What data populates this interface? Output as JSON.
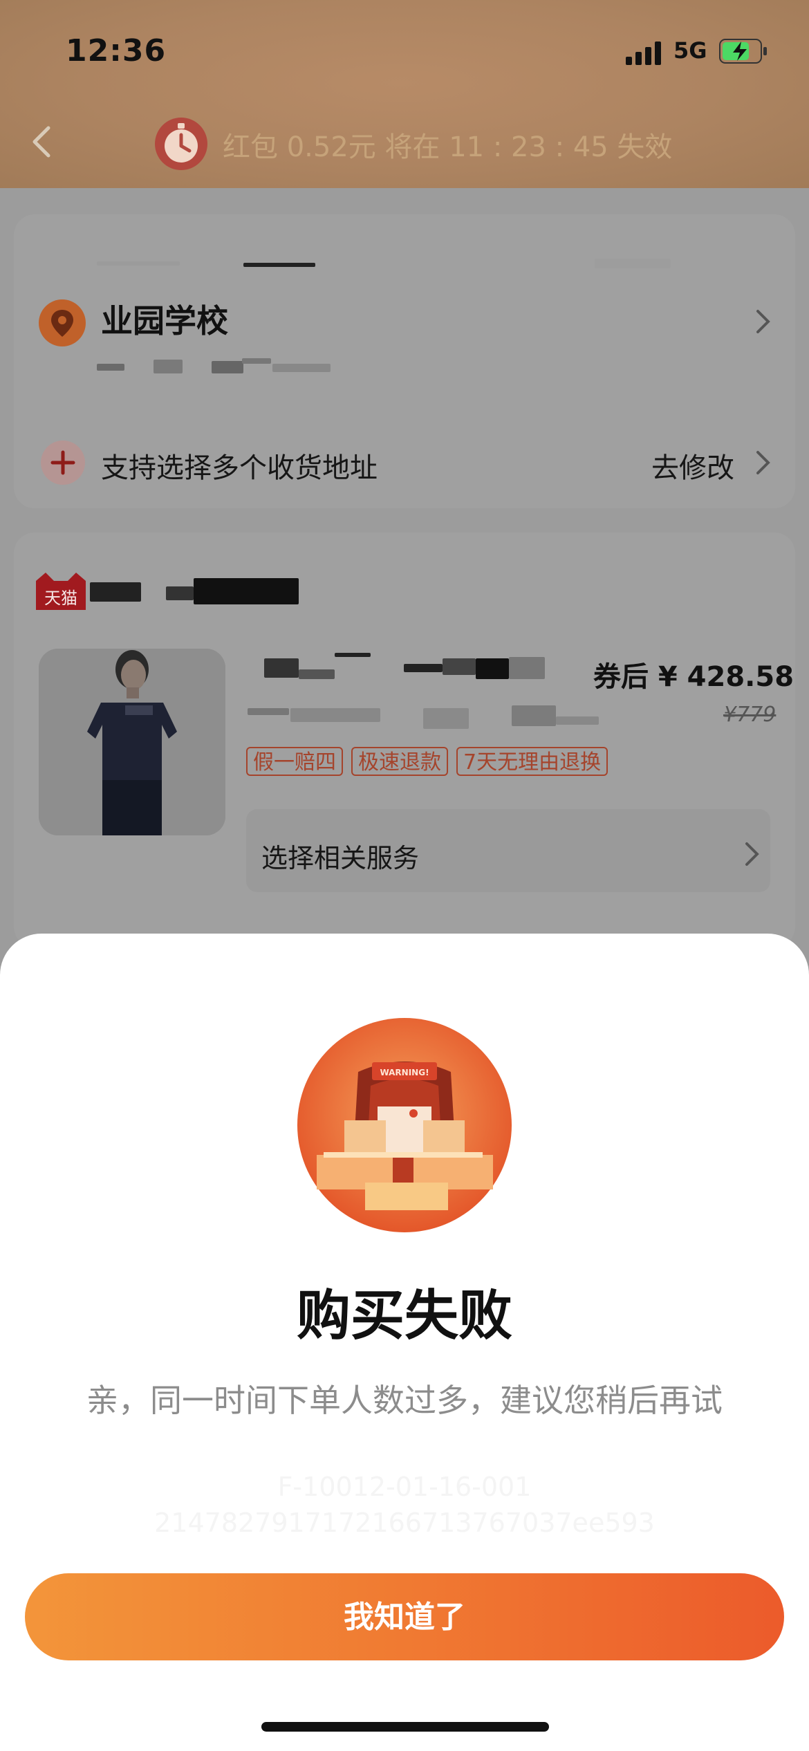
{
  "status_bar": {
    "time": "12:36",
    "network": "5G"
  },
  "header": {
    "countdown_text": "红包 0.52元 将在  11 : 23 : 45  失效"
  },
  "address": {
    "name": "业园学校",
    "multi_address": "支持选择多个收货地址",
    "edit": "去修改"
  },
  "shop": {
    "logo_text": "天猫"
  },
  "product": {
    "price": "券后 ¥ 428.58",
    "original_price": "¥779",
    "tags": [
      "假一赔四",
      "极速退款",
      "7天无理由退换"
    ],
    "service": "选择相关服务"
  },
  "dialog": {
    "title": "购买失败",
    "message": "亲，同一时间下单人数过多，建议您稍后再试",
    "error_code": "F-10012-01-16-001",
    "trace_id": "2147827917172166713767037ee593",
    "button": "我知道了",
    "illustration_label": "WARNING!"
  },
  "colors": {
    "accent": "#f07a32",
    "tag": "#a5442c"
  }
}
